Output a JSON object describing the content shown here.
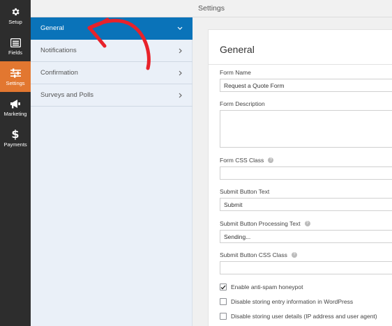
{
  "rail": {
    "items": [
      {
        "label": "Setup",
        "icon": "gear-icon"
      },
      {
        "label": "Fields",
        "icon": "fields-list-icon"
      },
      {
        "label": "Settings",
        "icon": "sliders-icon",
        "active": true
      },
      {
        "label": "Marketing",
        "icon": "megaphone-icon"
      },
      {
        "label": "Payments",
        "icon": "dollar-icon"
      }
    ],
    "active_color": "#e27730",
    "background": "#2d2d2d"
  },
  "topbar": {
    "title": "Settings"
  },
  "menu": {
    "items": [
      {
        "label": "General",
        "active": true,
        "chevron": "chevron-down"
      },
      {
        "label": "Notifications",
        "chevron": "chevron-right"
      },
      {
        "label": "Confirmation",
        "chevron": "chevron-right"
      },
      {
        "label": "Surveys and Polls",
        "chevron": "chevron-right"
      }
    ],
    "active_color": "#0a73b9"
  },
  "form": {
    "title": "General",
    "fields": {
      "form_name": {
        "label": "Form Name",
        "value": "Request a Quote Form"
      },
      "form_description": {
        "label": "Form Description",
        "value": ""
      },
      "form_css_class": {
        "label": "Form CSS Class",
        "value": ""
      },
      "submit_text": {
        "label": "Submit Button Text",
        "value": "Submit"
      },
      "submit_processing": {
        "label": "Submit Button Processing Text",
        "value": "Sending..."
      },
      "submit_css_class": {
        "label": "Submit Button CSS Class",
        "value": ""
      }
    },
    "checkboxes": [
      {
        "label": "Enable anti-spam honeypot",
        "checked": true
      },
      {
        "label": "Disable storing entry information in WordPress",
        "checked": false
      },
      {
        "label": "Disable storing user details (IP address and user agent)",
        "checked": false
      }
    ]
  },
  "annotation": {
    "arrow_color": "#e8222a"
  }
}
